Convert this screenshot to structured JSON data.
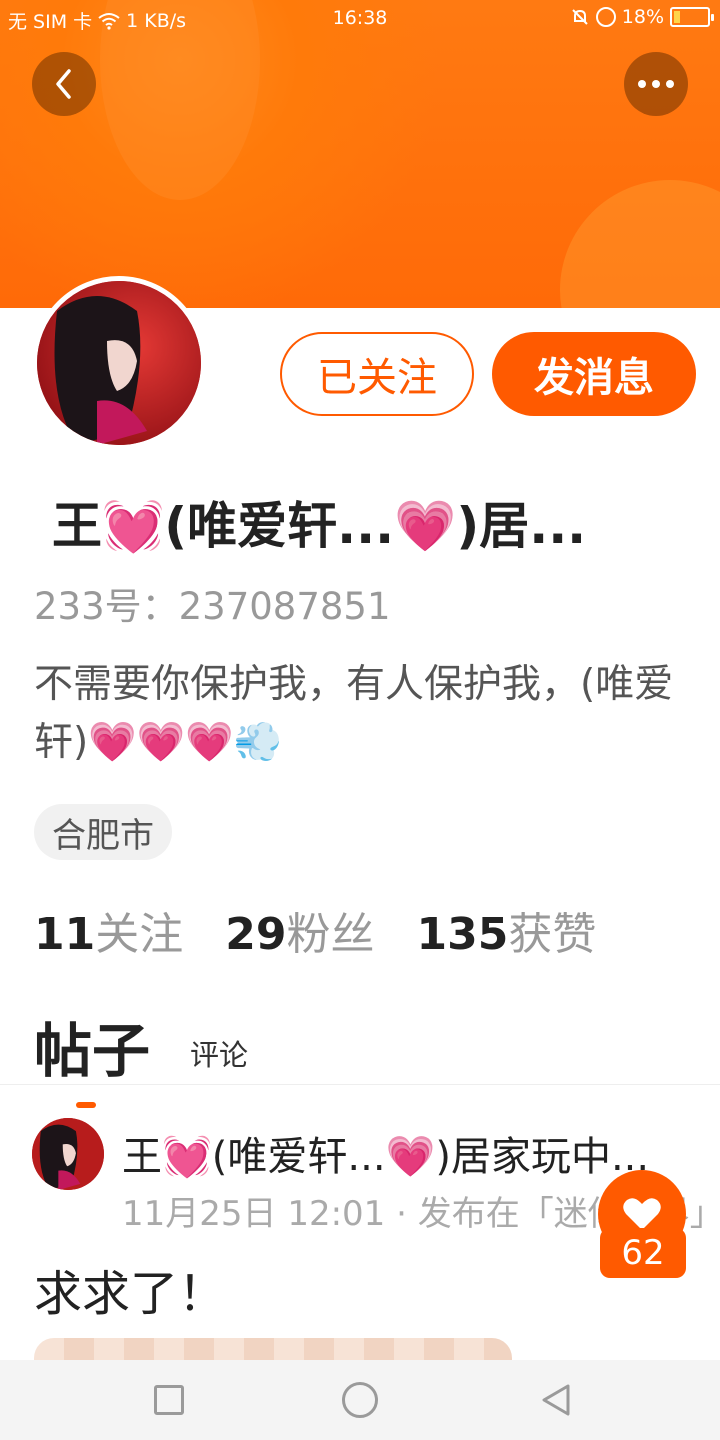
{
  "status_bar": {
    "carrier": "无 SIM 卡",
    "network_speed": "1 KB/s",
    "time": "16:38",
    "battery_percent": "18%",
    "battery_level": 0.18
  },
  "header": {
    "back_icon": "chevron-left-icon",
    "more_icon": "more-dots-icon",
    "accent_color": "#ff6a08"
  },
  "profile": {
    "follow_button": "已关注",
    "message_button": "发消息",
    "name": "王💓(唯爱轩...💗)居...",
    "uid": "233号：237087851",
    "bio": "不需要你保护我，有人保护我，(唯爱轩)💗💗💗💨",
    "location": "合肥市",
    "stats": [
      {
        "num": "11",
        "label": "关注"
      },
      {
        "num": "29",
        "label": "粉丝"
      },
      {
        "num": "135",
        "label": "获赞"
      }
    ]
  },
  "tabs": {
    "active": "帖子",
    "inactive": "评论"
  },
  "post": {
    "author": "王💓(唯爱轩...💗)居家玩中...",
    "meta": "11月25日 12:01 · 发布在「迷你世界」",
    "text": "求求了！",
    "like_count": "62"
  }
}
